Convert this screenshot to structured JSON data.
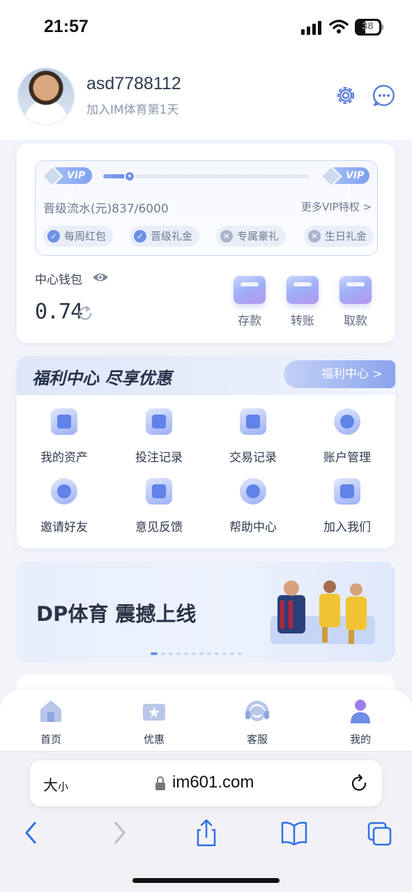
{
  "status": {
    "time": "21:57",
    "battery": "38"
  },
  "profile": {
    "username": "asd7788112",
    "subtitle": "加入IM体育第1天"
  },
  "vip": {
    "current": "VIP 0",
    "next": "VIP 1",
    "progress_fraction": 0.1395,
    "flow_text": "晋级流水(元)837/6000",
    "more_link": "更多VIP特权 >",
    "perks": [
      {
        "label": "每周红包",
        "status": "check"
      },
      {
        "label": "晋级礼金",
        "status": "check"
      },
      {
        "label": "专属豪礼",
        "status": "cross"
      },
      {
        "label": "生日礼金",
        "status": "cross"
      }
    ]
  },
  "wallet": {
    "label": "中心钱包",
    "balance": "0.74",
    "actions": [
      "存款",
      "转账",
      "取款"
    ]
  },
  "welfare": {
    "title": "福利中心 尽享优惠",
    "tab_label": "福利中心 >",
    "items": [
      {
        "label": "我的资产",
        "icon": "wallet-icon"
      },
      {
        "label": "投注记录",
        "icon": "calendar-clock-icon"
      },
      {
        "label": "交易记录",
        "icon": "calendar-yen-icon"
      },
      {
        "label": "账户管理",
        "icon": "user-hexagon-icon"
      },
      {
        "label": "邀请好友",
        "icon": "invite-icon"
      },
      {
        "label": "意见反馈",
        "icon": "heart-envelope-icon"
      },
      {
        "label": "帮助中心",
        "icon": "question-icon"
      },
      {
        "label": "加入我们",
        "icon": "heart-box-icon"
      }
    ]
  },
  "banner": {
    "title": "DP体育 震撼上线",
    "slide_count": 12,
    "active_slide": 0
  },
  "tabbar": {
    "items": [
      {
        "label": "首页",
        "icon": "home-icon"
      },
      {
        "label": "优惠",
        "icon": "ticket-icon"
      },
      {
        "label": "客服",
        "icon": "headset-icon"
      },
      {
        "label": "我的",
        "icon": "user-icon"
      }
    ]
  },
  "browser": {
    "text_size_big": "大",
    "text_size_small": "小",
    "url": "im601.com"
  },
  "colors": {
    "accent": "#6d8de6",
    "text": "#2a3346",
    "muted": "#8d97ab"
  }
}
